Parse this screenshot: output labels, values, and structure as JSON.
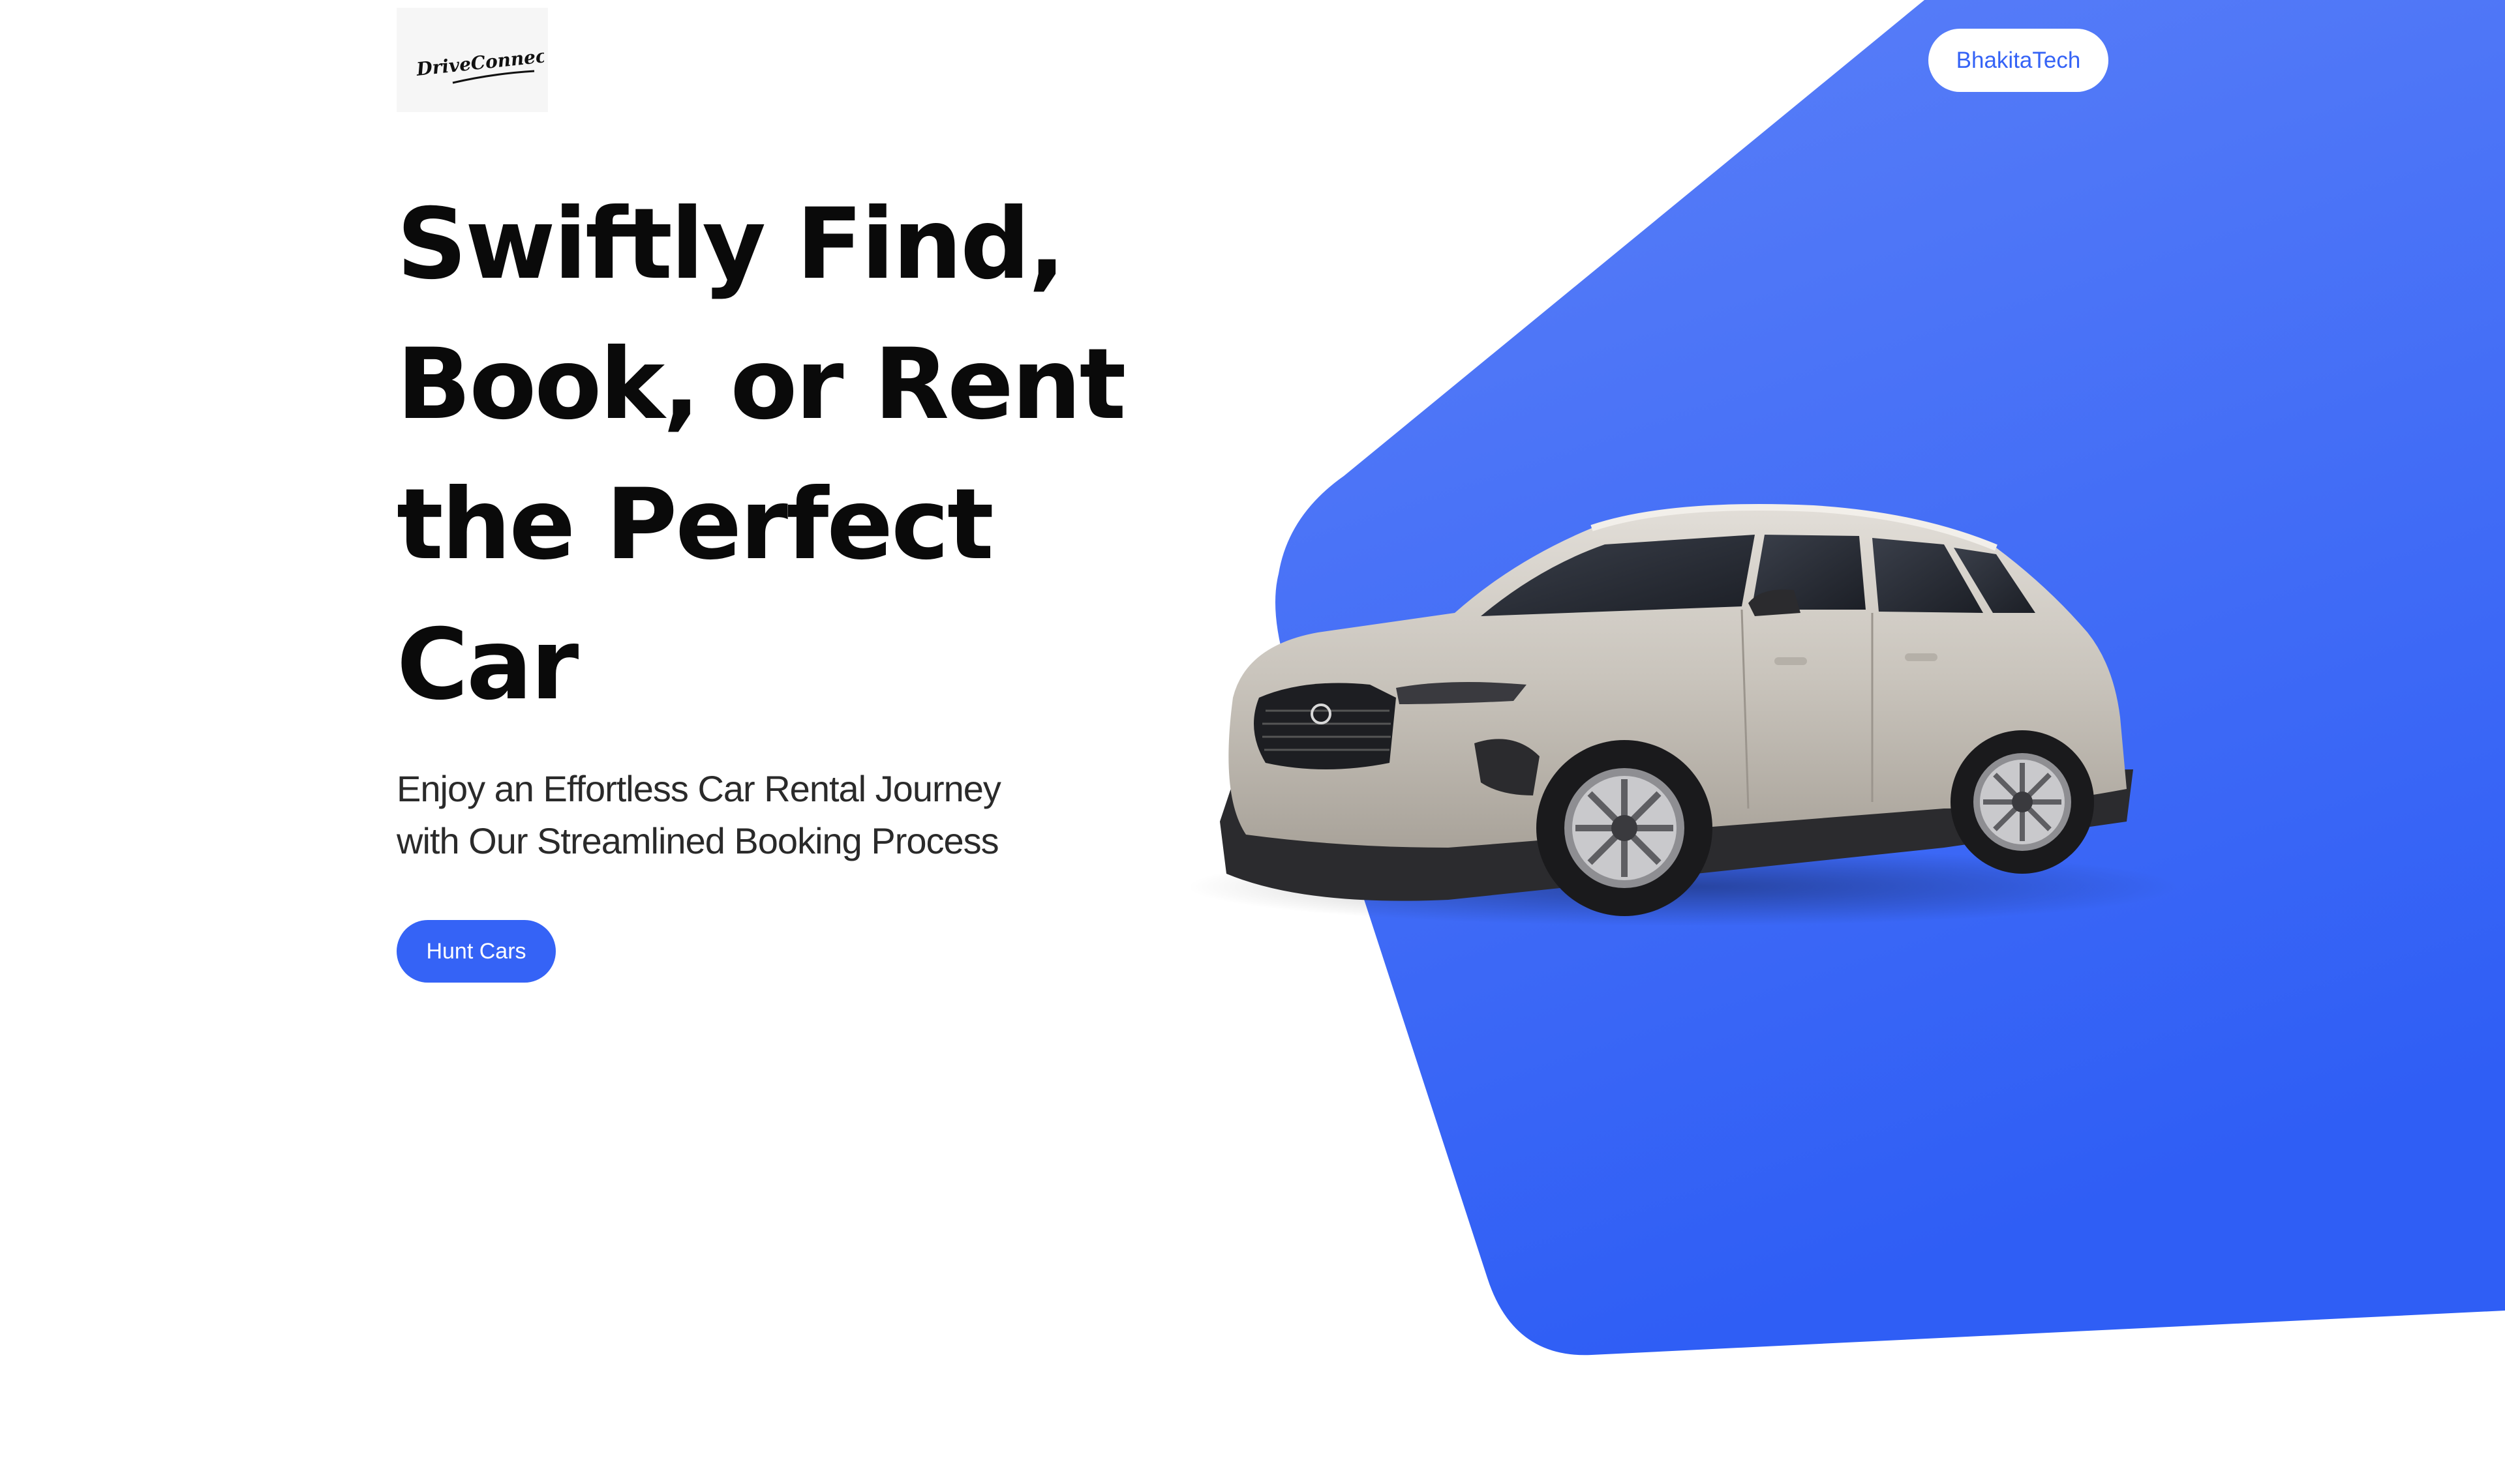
{
  "header": {
    "logo_text": "DriveConnect",
    "brand_button_label": "BhakitaTech"
  },
  "hero": {
    "headline_lines": [
      "Swiftly Find,",
      "Book, or Rent",
      "the Perfect",
      "Car"
    ],
    "subtext_lines": [
      "Enjoy an Effortless Car Rental Journey",
      "with Our Streamlined Booking Process"
    ],
    "cta_label": "Hunt Cars"
  },
  "colors": {
    "accent": "#3563f6",
    "accent_light": "#5b80f8",
    "text": "#0a0a0a",
    "background": "#ffffff"
  },
  "icons": {
    "car_image": "suv-car-image",
    "logo": "driveconnect-logo"
  }
}
